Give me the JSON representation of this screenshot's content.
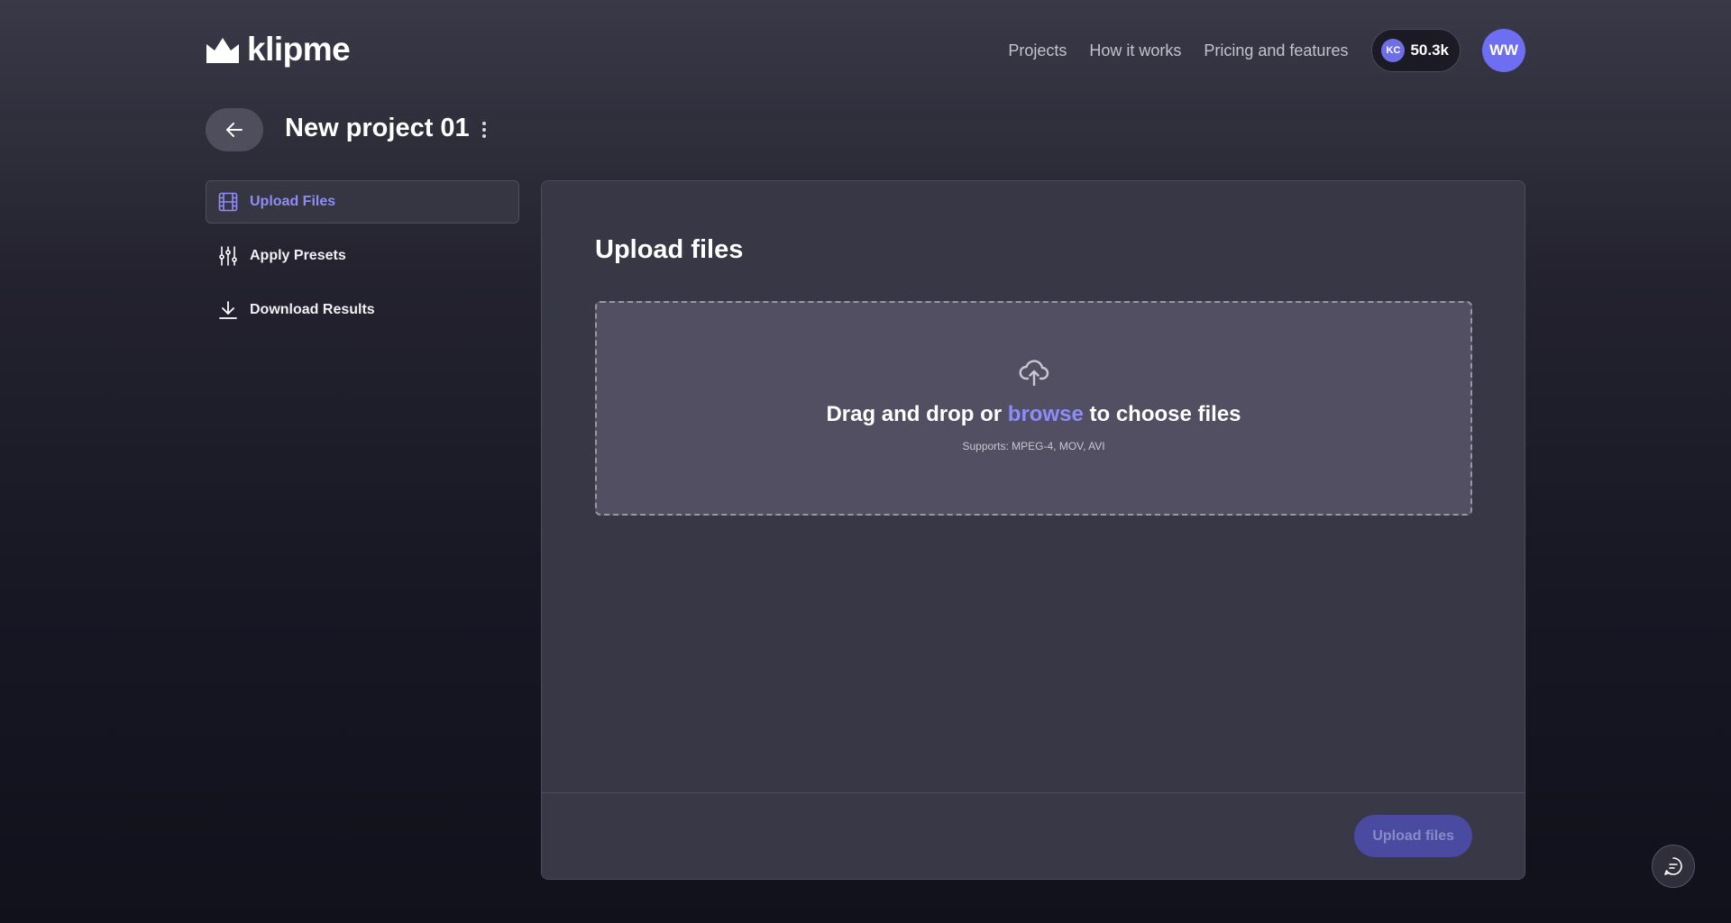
{
  "brand": {
    "name": "klipme"
  },
  "nav": {
    "links": [
      "Projects",
      "How it works",
      "Pricing and features"
    ],
    "credits": {
      "badge": "KC",
      "value": "50.3k"
    },
    "avatar_initials": "WW"
  },
  "project": {
    "title": "New project 01"
  },
  "sidebar": {
    "items": [
      {
        "label": "Upload Files",
        "icon": "film-icon",
        "active": true
      },
      {
        "label": "Apply Presets",
        "icon": "sliders-icon",
        "active": false
      },
      {
        "label": "Download Results",
        "icon": "download-icon",
        "active": false
      }
    ]
  },
  "main": {
    "title": "Upload files",
    "dropzone": {
      "text_before": "Drag and drop or ",
      "link": "browse",
      "text_after": " to choose files",
      "supports": "Supports: MPEG-4, MOV, AVI"
    },
    "upload_button": "Upload files"
  },
  "colors": {
    "accent": "#8e8cf6",
    "avatar": "#6e6ef2",
    "panel": "#383745",
    "dropzone": "#514f61"
  }
}
